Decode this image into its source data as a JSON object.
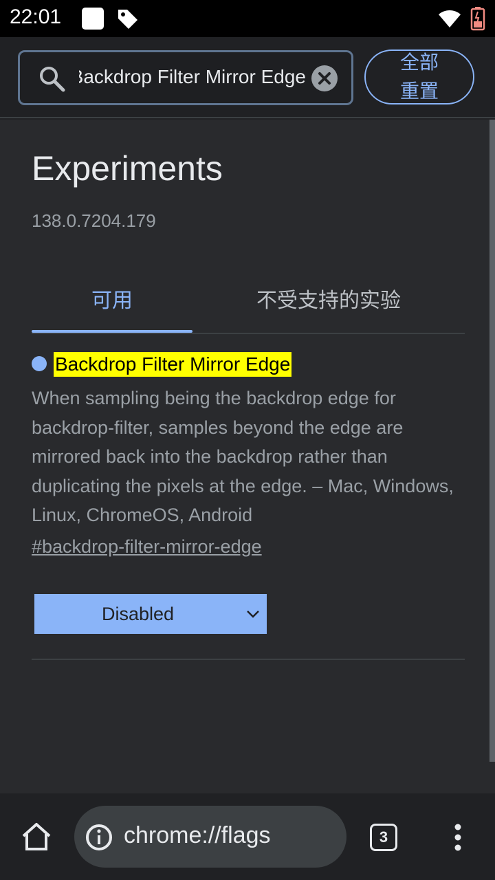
{
  "status_bar": {
    "time": "22:01",
    "icons": [
      "square-notification-icon",
      "tag-icon",
      "wifi-icon",
      "battery-icon"
    ]
  },
  "search": {
    "value": "Backdrop Filter Mirror Edge",
    "clear_icon": "clear-icon"
  },
  "reset_button": {
    "label": "全部重置"
  },
  "page": {
    "title": "Experiments",
    "version": "138.0.7204.179"
  },
  "tabs": [
    {
      "label": "可用",
      "selected": true
    },
    {
      "label": "不受支持的实验",
      "selected": false
    }
  ],
  "experiment": {
    "title": "Backdrop Filter Mirror Edge",
    "description": "When sampling being the backdrop edge for backdrop-filter, samples beyond the edge are mirrored back into the backdrop rather than duplicating the pixels at the edge. – Mac, Windows, Linux, ChromeOS, Android",
    "link": "#backdrop-filter-mirror-edge",
    "select_value": "Disabled"
  },
  "toolbar": {
    "url": "chrome://flags",
    "tab_count": "3"
  },
  "colors": {
    "accent": "#8ab4f8",
    "highlight": "#ffff00",
    "background": "#292a2d"
  }
}
